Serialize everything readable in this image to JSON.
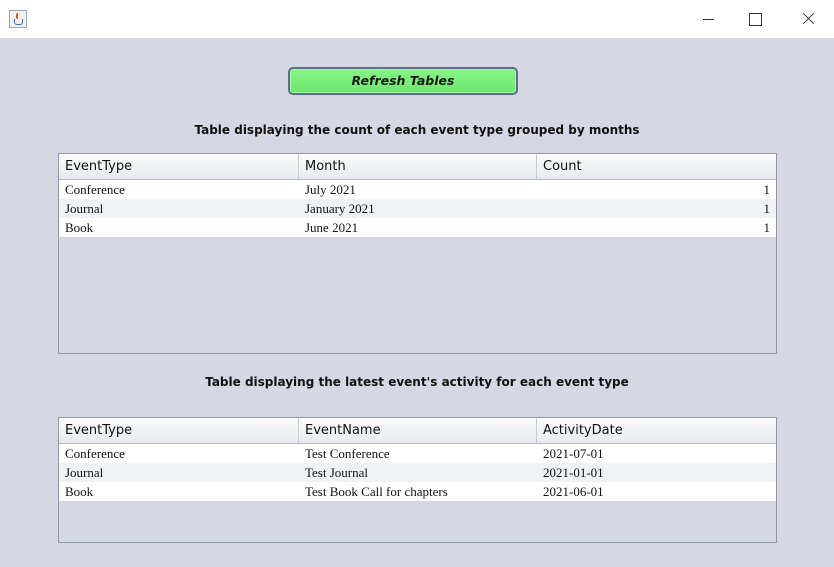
{
  "window": {
    "icon": "java-cup-icon"
  },
  "refresh_button": {
    "label": "Refresh Tables"
  },
  "table1": {
    "caption": "Table displaying the count of each event type grouped by months",
    "columns": [
      "EventType",
      "Month",
      "Count"
    ],
    "rows": [
      [
        "Conference",
        "July 2021",
        "1"
      ],
      [
        "Journal",
        "January 2021",
        "1"
      ],
      [
        "Book",
        "June 2021",
        "1"
      ]
    ]
  },
  "table2": {
    "caption": "Table displaying the latest event's activity for each event type",
    "columns": [
      "EventType",
      "EventName",
      "ActivityDate"
    ],
    "rows": [
      [
        "Conference",
        "Test Conference",
        "2021-07-01"
      ],
      [
        "Journal",
        "Test Journal",
        "2021-01-01"
      ],
      [
        "Book",
        "Test Book Call for chapters",
        "2021-06-01"
      ]
    ]
  },
  "colors": {
    "button_green": "#7aee7a",
    "panel_bg": "#d5d8e2"
  }
}
